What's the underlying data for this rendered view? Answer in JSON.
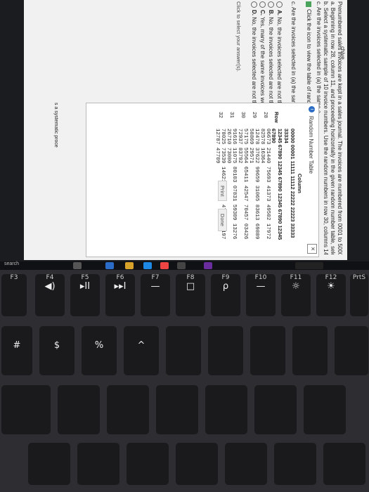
{
  "question": {
    "intro": "Prenumbered sales invoices are kept in a sales journal. The invoices are numbered from 0001 to 5000.",
    "part_a": "a. Beginning in row 28, column 11, and proceeding horizontally in the given random number table, select a simple random sample of 10 invoice numbers.",
    "part_b": "b. Select a systematic sample of 10 invoice numbers. Use the random numbers in row 30, columns 14–16, as the starting point for your selection.",
    "part_c": "c. Are the invoices selected in (a) the same a",
    "icon_prompt": "Click the icon to view the table of random",
    "part_c_repeat": "c. Are the invoices selected in (a) the same a",
    "side_note": "s a systematic proce",
    "archive_label": "chive",
    "hint": "Click to select your answer(s).",
    "options": [
      {
        "letter": "A.",
        "text": "No, the invoices selected are not the s"
      },
      {
        "letter": "B.",
        "text": "No, the invoices selected are not the s"
      },
      {
        "letter": "C.",
        "text": "Yes, many of the same invoices were"
      },
      {
        "letter": "D.",
        "text": "No, the invoices selected are not the"
      }
    ]
  },
  "modal": {
    "title": "Random Number Table",
    "info_icon": "info-icon",
    "column_header": "Column",
    "row_header": "Row",
    "column_groups": [
      "00000 00001 11111 11112 22222 22223 33333 33334",
      "12345 67890 12345 67890 12345 67890 12345 67890"
    ],
    "rows": [
      {
        "row": "28",
        "values": "06673 21440 75693 41373 49502 17972 82578 16364"
      },
      {
        "row": "29",
        "values": "12478 37622 99659 31065 83613 69889 58869 29571"
      },
      {
        "row": "30",
        "values": "57175 55564 65411 42547 70457 03426 72937 83792"
      },
      {
        "row": "31",
        "values": "91616 11075 80103 07831 59309 13276 26710 73000"
      },
      {
        "row": "32",
        "values": "78025 73539 14621 39044 47450 03197 12787 47709"
      }
    ],
    "print_label": "Print",
    "done_label": "Done"
  },
  "taskbar": {
    "search_label": "search"
  },
  "keyboard": {
    "fn_row": [
      {
        "top": "F3",
        "sub": ""
      },
      {
        "top": "F4",
        "sub": "◀)"
      },
      {
        "top": "F5",
        "sub": "▸II"
      },
      {
        "top": "F6",
        "sub": "▸▸I"
      },
      {
        "top": "F7",
        "sub": "—"
      },
      {
        "top": "F8",
        "sub": "□"
      },
      {
        "top": "F9",
        "sub": "ρ"
      },
      {
        "top": "F10",
        "sub": "—"
      },
      {
        "top": "F11",
        "sub": "☼"
      },
      {
        "top": "F12",
        "sub": "☀"
      },
      {
        "top": "PrtS",
        "sub": ""
      }
    ],
    "num_row": [
      {
        "top": "",
        "sub": "#"
      },
      {
        "top": "",
        "sub": "$"
      },
      {
        "top": "",
        "sub": "%"
      },
      {
        "top": "",
        "sub": "^"
      }
    ]
  }
}
